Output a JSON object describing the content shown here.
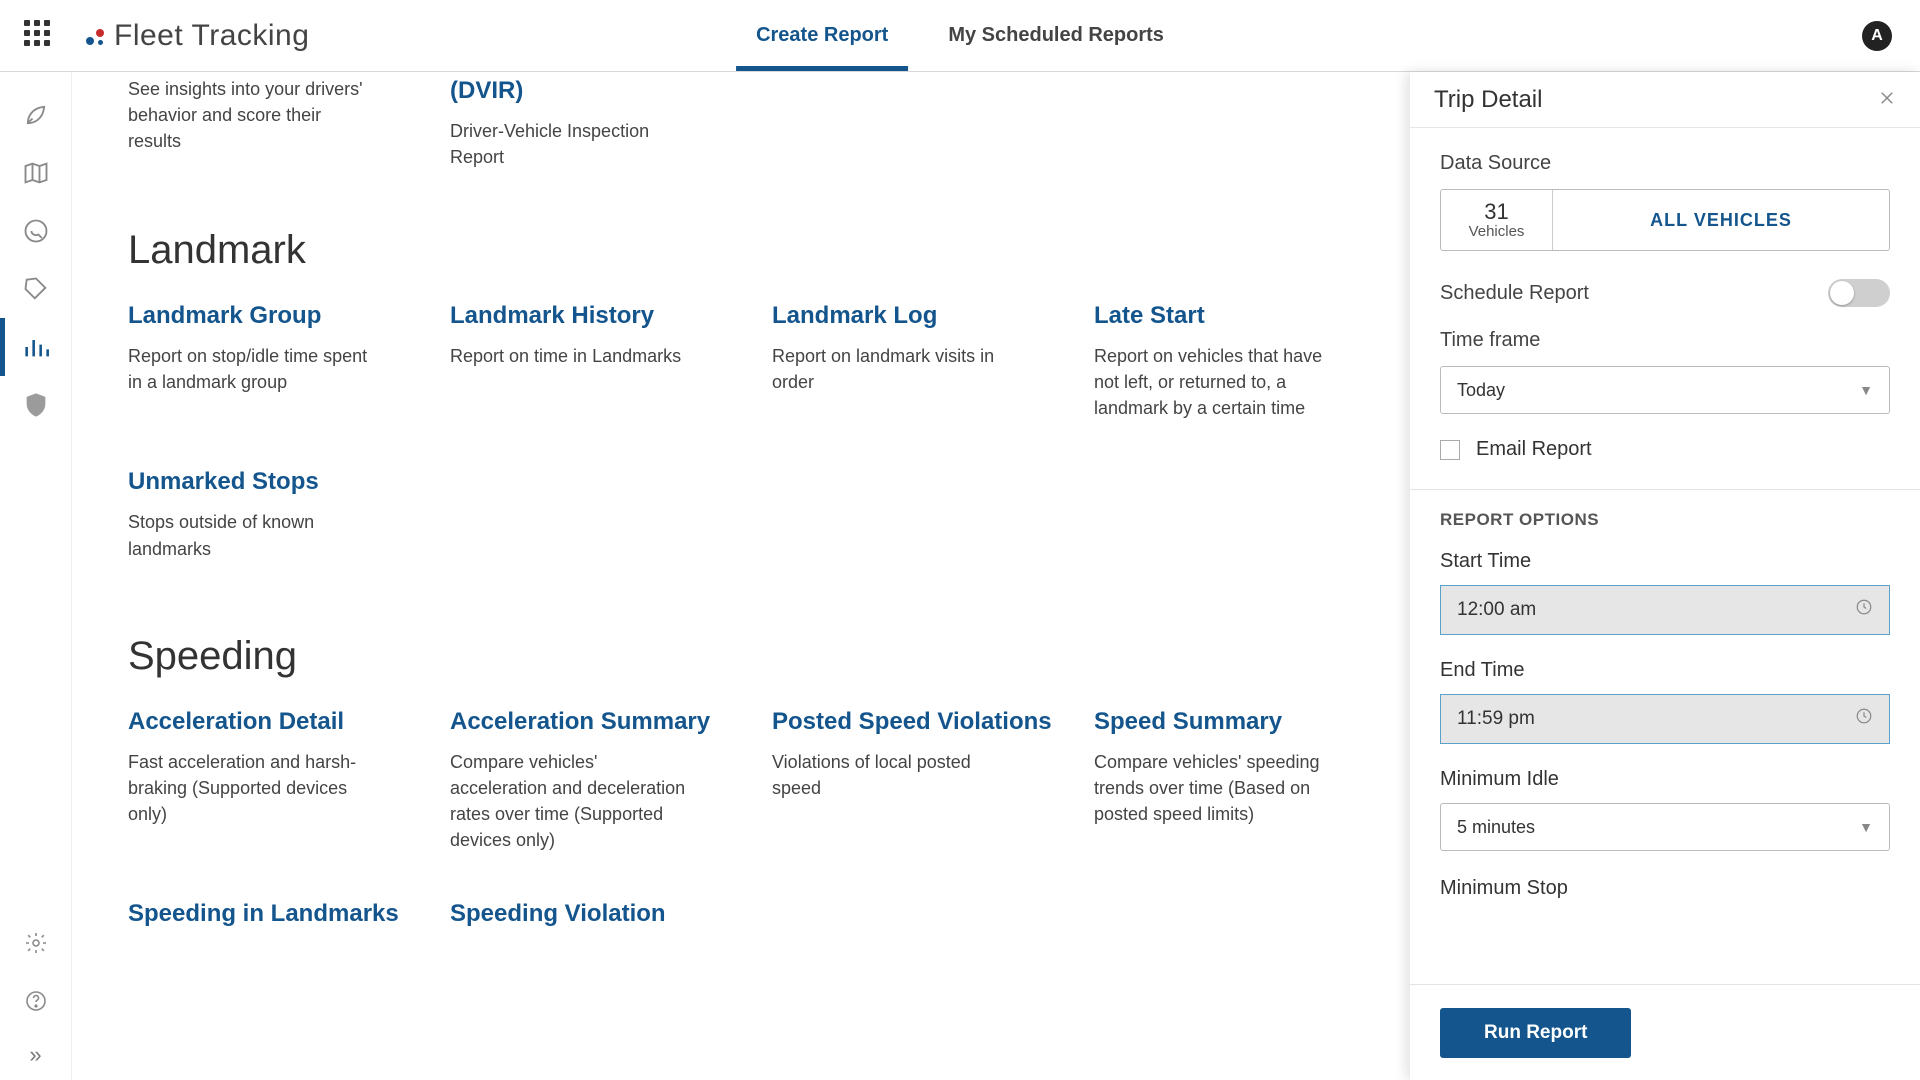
{
  "header": {
    "app_title": "Fleet Tracking",
    "tabs": {
      "create": "Create Report",
      "scheduled": "My Scheduled Reports"
    },
    "avatar_letter": "A"
  },
  "top_partial": {
    "driver": {
      "desc": "See insights into your drivers' behavior and score their results"
    },
    "dvir": {
      "title": "(DVIR)",
      "desc": "Driver-Vehicle Inspection Report"
    }
  },
  "sections": {
    "landmark": {
      "title": "Landmark",
      "cards": [
        {
          "title": "Landmark Group",
          "desc": "Report on stop/idle time spent in a landmark group"
        },
        {
          "title": "Landmark History",
          "desc": "Report on time in Landmarks"
        },
        {
          "title": "Landmark Log",
          "desc": "Report on landmark visits in order"
        },
        {
          "title": "Late Start",
          "desc": "Report on vehicles that have not left, or returned to, a landmark by a certain time"
        },
        {
          "title": "Unmarked Stops",
          "desc": "Stops outside of known landmarks"
        }
      ]
    },
    "speeding": {
      "title": "Speeding",
      "cards": [
        {
          "title": "Acceleration Detail",
          "desc": "Fast acceleration and harsh-braking (Supported devices only)"
        },
        {
          "title": "Acceleration Summary",
          "desc": "Compare vehicles' acceleration and deceleration rates over time (Supported devices only)"
        },
        {
          "title": "Posted Speed Violations",
          "desc": "Violations of local posted speed"
        },
        {
          "title": "Speed Summary",
          "desc": "Compare vehicles' speeding trends over time (Based on posted speed limits)"
        },
        {
          "title": "Speeding in Landmarks",
          "desc": ""
        },
        {
          "title": "Speeding Violation",
          "desc": ""
        }
      ]
    }
  },
  "panel": {
    "title": "Trip Detail",
    "data_source_label": "Data Source",
    "vehicle_count": "31",
    "vehicle_label": "Vehicles",
    "all_vehicles": "ALL VEHICLES",
    "schedule_label": "Schedule Report",
    "timeframe_label": "Time frame",
    "timeframe_value": "Today",
    "email_label": "Email Report",
    "options_header": "REPORT OPTIONS",
    "start_label": "Start Time",
    "start_value": "12:00 am",
    "end_label": "End Time",
    "end_value": "11:59 pm",
    "min_idle_label": "Minimum Idle",
    "min_idle_value": "5 minutes",
    "min_stop_label": "Minimum Stop",
    "run_button": "Run Report"
  }
}
